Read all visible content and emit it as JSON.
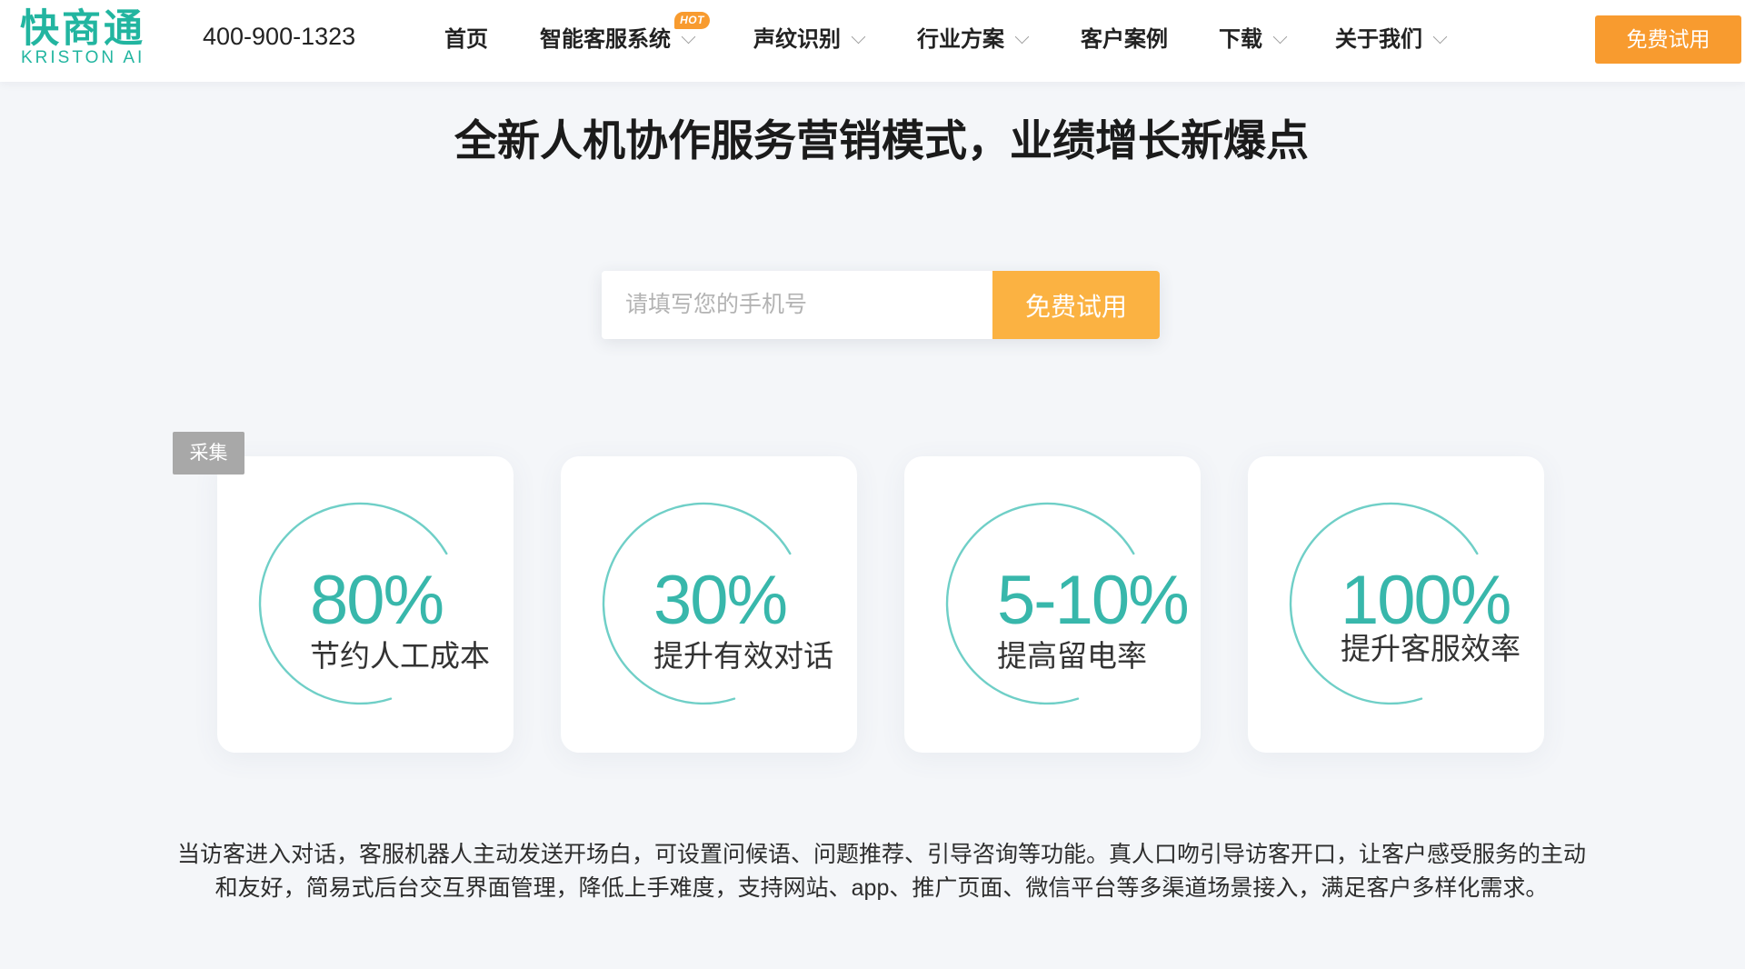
{
  "header": {
    "logo": {
      "name": "快商通",
      "subtitle": "KRISTON AI"
    },
    "phone": "400-900-1323",
    "nav": [
      {
        "label": "首页"
      },
      {
        "label": "智能客服系统",
        "dropdown_icon": "chevron-down-icon",
        "badge": "HOT"
      },
      {
        "label": "声纹识别",
        "dropdown_icon": "chevron-down-icon"
      },
      {
        "label": "行业方案",
        "dropdown_icon": "chevron-down-icon"
      },
      {
        "label": "客户案例"
      },
      {
        "label": "下载",
        "dropdown_icon": "chevron-down-icon"
      },
      {
        "label": "关于我们",
        "dropdown_icon": "chevron-down-icon"
      }
    ],
    "cta_label": "免费试用"
  },
  "hero": {
    "title": "全新人机协作服务营销模式，业绩增长新爆点",
    "phone_input": {
      "value": "",
      "placeholder": "请填写您的手机号"
    },
    "submit_label": "免费试用"
  },
  "collect_tag": "采集",
  "stats": [
    {
      "value": "80%",
      "label": "节约人工成本"
    },
    {
      "value": "30%",
      "label": "提升有效对话"
    },
    {
      "value": "5-10%",
      "label": "提高留电率"
    },
    {
      "value": "100%",
      "label": "提升客服效率"
    }
  ],
  "description": {
    "lines": [
      "当访客进入对话，客服机器人主动发送开场白，可设置问候语、问题推荐、引导咨询等功能。真人口吻引导访客开口，让客户感受服务的主动",
      "和友好，简易式后台交互界面管理，降低上手难度，支持网站、app、推广页面、微信平台等多渠道场景接入，满足客户多样化需求。"
    ]
  },
  "colors": {
    "brand": "#22b5a0",
    "cta_orange": "#f89b2f",
    "submit_orange": "#fbb242",
    "stat_teal": "#38b7ab",
    "ring_teal": "#6fcfc7",
    "page_background": "#f4f6f9"
  }
}
